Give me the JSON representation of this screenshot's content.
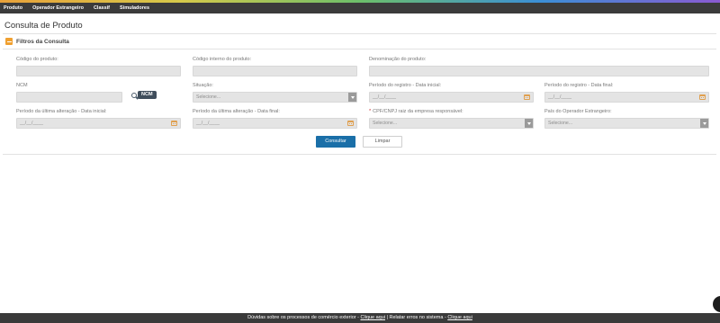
{
  "nav": {
    "items": [
      "Produto",
      "Operador Estrangeiro",
      "Classif",
      "Simuladores"
    ]
  },
  "page": {
    "title": "Consulta de Produto"
  },
  "section": {
    "title": "Filtros da Consulta"
  },
  "form": {
    "codigo_produto": {
      "label": "Código do produto:",
      "value": ""
    },
    "codigo_interno": {
      "label": "Código interno do produto:",
      "value": ""
    },
    "denominacao": {
      "label": "Denominação do produto:",
      "value": ""
    },
    "ncm": {
      "label": "NCM",
      "value": "",
      "tooltip": "NCM"
    },
    "situacao": {
      "label": "Situação:",
      "selected": "Selecione..."
    },
    "registro_inicial": {
      "label": "Período do registro - Data inicial:",
      "placeholder": "__/__/____"
    },
    "registro_final": {
      "label": "Período do registro - Data final:",
      "placeholder": "__/__/____"
    },
    "alteracao_inicial": {
      "label": "Período da última alteração - Data inicial:",
      "placeholder": "__/__/____"
    },
    "alteracao_final": {
      "label": "Período da última alteração - Data final:",
      "placeholder": "__/__/____"
    },
    "cpf_cnpj": {
      "label": "CPF/CNPJ raiz da empresa responsável:",
      "required_mark": "*",
      "selected": "Selecione..."
    },
    "pais_operador": {
      "label": "País do Operador Estrangeiro:",
      "selected": "Selecione..."
    }
  },
  "buttons": {
    "consultar": "Consultar",
    "limpar": "Limpar"
  },
  "footer": {
    "text1": "Dúvidas sobre os processos de comércio exterior - ",
    "link1": "Clique aqui",
    "text2": " | Relatar erros no sistema - ",
    "link2": "Clique aqui"
  },
  "colors": {
    "nav_bg": "#3b3b3b",
    "primary": "#1a6fa8",
    "accent": "#f0a030",
    "footer_bg": "#3a3a3a"
  },
  "icons": [
    "calendar-icon",
    "dropdown-arrow-icon",
    "collapse-toggle-icon",
    "search-icon",
    "chat-icon"
  ]
}
